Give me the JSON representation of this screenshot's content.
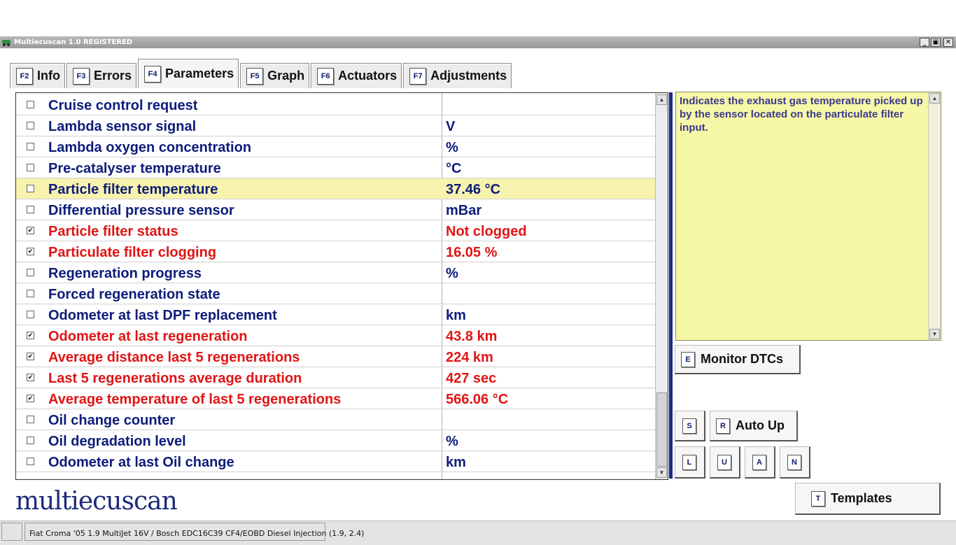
{
  "window": {
    "title": "Multiecuscan 1.0 REGISTERED",
    "controls": {
      "minimize": "_",
      "restore": "▣",
      "close": "✕"
    }
  },
  "tabs": [
    {
      "key": "F2",
      "label": "Info"
    },
    {
      "key": "F3",
      "label": "Errors"
    },
    {
      "key": "F4",
      "label": "Parameters"
    },
    {
      "key": "F5",
      "label": "Graph"
    },
    {
      "key": "F6",
      "label": "Actuators"
    },
    {
      "key": "F7",
      "label": "Adjustments"
    }
  ],
  "active_tab": "Parameters",
  "parameters": [
    {
      "name": "Cruise control request",
      "value": "",
      "checked": false,
      "highlight": false,
      "active": false
    },
    {
      "name": "Lambda sensor signal",
      "value": " V",
      "checked": false,
      "highlight": false,
      "active": false
    },
    {
      "name": "Lambda oxygen concentration",
      "value": " %",
      "checked": false,
      "highlight": false,
      "active": false
    },
    {
      "name": "Pre-catalyser temperature",
      "value": " °C",
      "checked": false,
      "highlight": false,
      "active": false
    },
    {
      "name": "Particle filter temperature",
      "value": "37.46 °C",
      "checked": false,
      "highlight": true,
      "active": false
    },
    {
      "name": "Differential pressure sensor",
      "value": " mBar",
      "checked": false,
      "highlight": false,
      "active": false
    },
    {
      "name": "Particle filter status",
      "value": "Not clogged",
      "checked": true,
      "highlight": false,
      "active": true
    },
    {
      "name": "Particulate filter clogging",
      "value": "16.05 %",
      "checked": true,
      "highlight": false,
      "active": true
    },
    {
      "name": "Regeneration progress",
      "value": " %",
      "checked": false,
      "highlight": false,
      "active": false
    },
    {
      "name": "Forced regeneration state",
      "value": "",
      "checked": false,
      "highlight": false,
      "active": false
    },
    {
      "name": "Odometer at last DPF replacement",
      "value": " km",
      "checked": false,
      "highlight": false,
      "active": false
    },
    {
      "name": "Odometer at last regeneration",
      "value": "43.8 km",
      "checked": true,
      "highlight": false,
      "active": true
    },
    {
      "name": "Average distance last 5 regenerations",
      "value": "224 km",
      "checked": true,
      "highlight": false,
      "active": true
    },
    {
      "name": "Last 5 regenerations average duration",
      "value": "427 sec",
      "checked": true,
      "highlight": false,
      "active": true
    },
    {
      "name": "Average temperature of last 5 regenerations",
      "value": "566.06 °C",
      "checked": true,
      "highlight": false,
      "active": true
    },
    {
      "name": "Oil change counter",
      "value": "",
      "checked": false,
      "highlight": false,
      "active": false
    },
    {
      "name": "Oil degradation level",
      "value": " %",
      "checked": false,
      "highlight": false,
      "active": false
    },
    {
      "name": "Odometer at last Oil change",
      "value": " km",
      "checked": false,
      "highlight": false,
      "active": false
    }
  ],
  "description": "Indicates the exhaust gas temperature picked up by the sensor located on the particulate filter input.",
  "buttons": {
    "monitor_dtcs": {
      "key": "E",
      "label": "Monitor DTCs"
    },
    "s": {
      "key": "S"
    },
    "auto_up": {
      "key": "R",
      "label": "Auto Up"
    },
    "l": {
      "key": "L"
    },
    "u": {
      "key": "U"
    },
    "a": {
      "key": "A"
    },
    "n": {
      "key": "N"
    },
    "templates": {
      "key": "T",
      "label": "Templates"
    }
  },
  "logo": "multiecuscan",
  "status": {
    "vehicle": "Fiat Croma '05 1.9 MultiJet 16V / Bosch EDC16C39 CF4/EOBD Diesel Injection (1.9, 2.4)"
  },
  "colors": {
    "param_text": "#0d1c7a",
    "active_text": "#e01414",
    "highlight_row": "#f7f3ae",
    "description_bg": "#f7f7a8"
  }
}
